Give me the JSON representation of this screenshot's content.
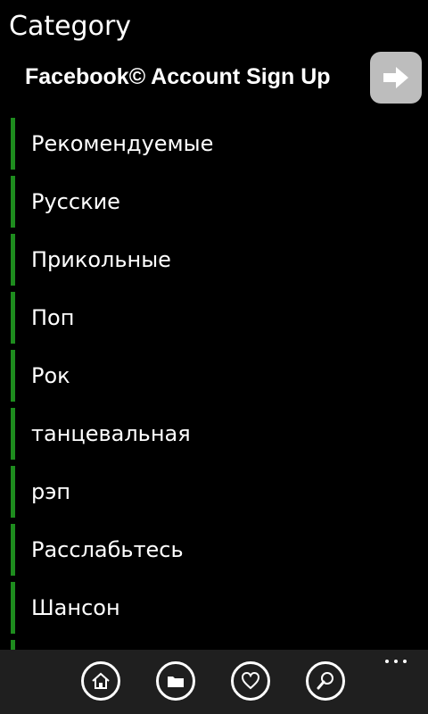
{
  "page": {
    "title": "Category"
  },
  "banner": {
    "text": "Facebook© Account Sign Up",
    "icon": "arrow-right-icon"
  },
  "categories": [
    "Рекомендуемые",
    "Русские",
    "Прикольные",
    "Поп",
    "Рок",
    "танцевальная",
    "рэп",
    "Расслабьтесь",
    "Шансон"
  ],
  "app_bar": {
    "buttons": [
      "home-icon",
      "folder-icon",
      "heart-icon",
      "search-icon"
    ],
    "more": "more-icon"
  },
  "colors": {
    "accent": "#1e8c1e",
    "background": "#000000",
    "app_bar": "#1f1f1f",
    "banner_button": "#bdbdbd"
  }
}
